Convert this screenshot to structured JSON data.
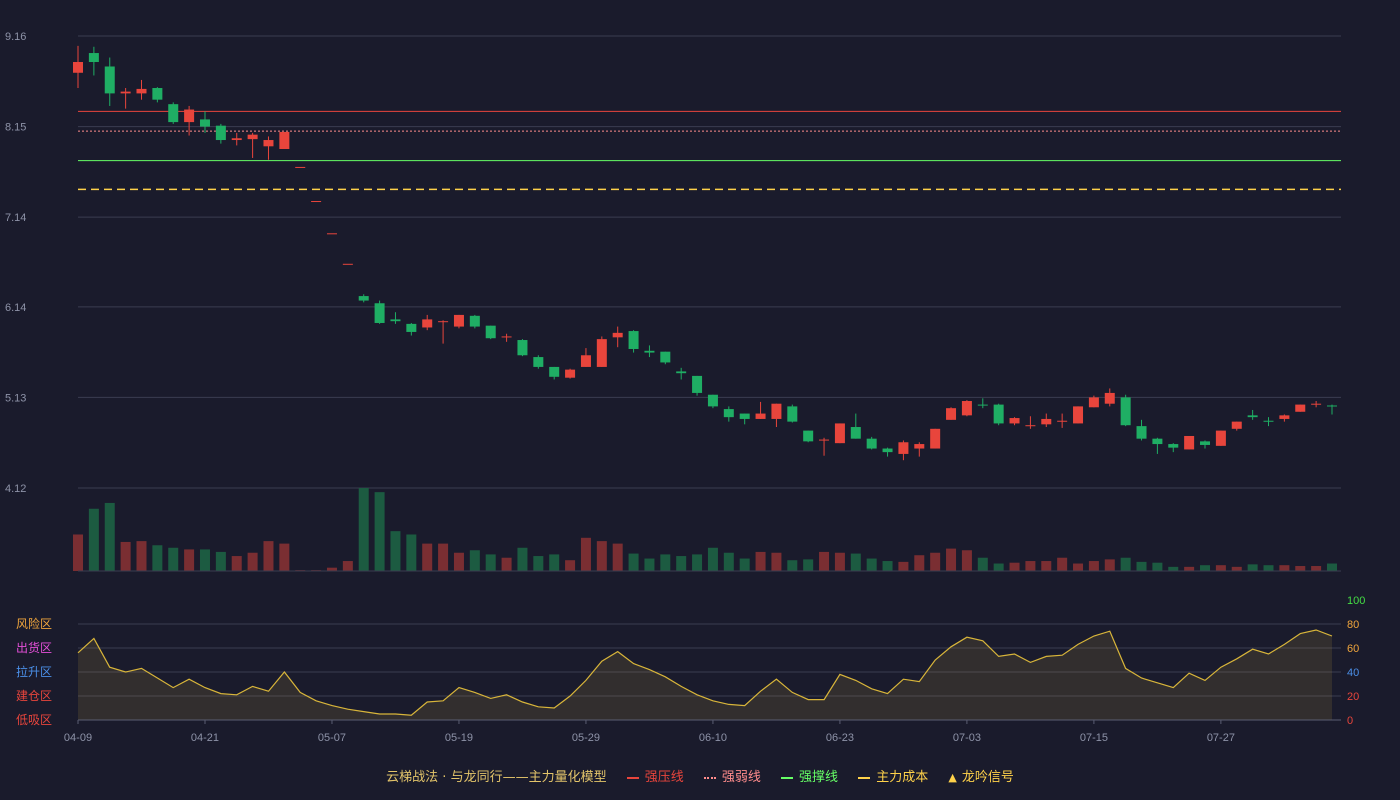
{
  "chart_data": {
    "type": "candlestick",
    "title": "",
    "price_axis": {
      "ticks": [
        "9.16",
        "8.15",
        "7.14",
        "6.14",
        "5.13",
        "4.12"
      ],
      "ylim": [
        4.12,
        9.16
      ]
    },
    "indicator_axis": {
      "ticks": [
        "100",
        "80",
        "60",
        "40",
        "20",
        "0"
      ],
      "ylim": [
        0,
        100
      ]
    },
    "zones": [
      "风险区",
      "出货区",
      "拉升区",
      "建仓区",
      "低吸区"
    ],
    "x_ticks": [
      "04-09",
      "04-21",
      "05-07",
      "05-19",
      "05-29",
      "06-10",
      "06-23",
      "07-03",
      "07-15",
      "07-27"
    ],
    "x_tick_index": [
      0,
      8,
      16,
      24,
      32,
      40,
      48,
      56,
      64,
      72
    ],
    "lines": {
      "strong_resist": 8.32,
      "weak_resist": 8.1,
      "support": 7.77,
      "main_cost": 7.45
    },
    "candles": [
      [
        8.75,
        8.87,
        9.05,
        8.58
      ],
      [
        8.97,
        8.87,
        9.04,
        8.72
      ],
      [
        8.82,
        8.52,
        8.92,
        8.38
      ],
      [
        8.52,
        8.54,
        8.58,
        8.35
      ],
      [
        8.52,
        8.57,
        8.67,
        8.45
      ],
      [
        8.58,
        8.45,
        8.59,
        8.42
      ],
      [
        8.4,
        8.2,
        8.42,
        8.18
      ],
      [
        8.2,
        8.34,
        8.38,
        8.05
      ],
      [
        8.23,
        8.15,
        8.32,
        8.08
      ],
      [
        8.16,
        8.0,
        8.18,
        7.96
      ],
      [
        8.0,
        8.02,
        8.08,
        7.94
      ],
      [
        8.01,
        8.06,
        8.08,
        7.8
      ],
      [
        7.93,
        8.0,
        8.04,
        7.78
      ],
      [
        7.9,
        8.09,
        8.09,
        7.9
      ],
      [
        7.7,
        7.7,
        7.7,
        7.7
      ],
      [
        7.32,
        7.32,
        7.32,
        7.32
      ],
      [
        6.96,
        6.96,
        6.96,
        6.96
      ],
      [
        6.62,
        6.62,
        6.62,
        6.62
      ],
      [
        6.26,
        6.21,
        6.28,
        6.19
      ],
      [
        6.18,
        5.96,
        6.21,
        5.95
      ],
      [
        6.0,
        5.98,
        6.08,
        5.95
      ],
      [
        5.95,
        5.86,
        5.96,
        5.82
      ],
      [
        5.91,
        6.0,
        6.05,
        5.88
      ],
      [
        5.98,
        5.98,
        5.99,
        5.73
      ],
      [
        5.92,
        6.05,
        6.05,
        5.9
      ],
      [
        6.04,
        5.92,
        6.05,
        5.9
      ],
      [
        5.93,
        5.79,
        5.93,
        5.78
      ],
      [
        5.8,
        5.81,
        5.84,
        5.75
      ],
      [
        5.77,
        5.6,
        5.78,
        5.59
      ],
      [
        5.58,
        5.47,
        5.6,
        5.45
      ],
      [
        5.47,
        5.36,
        5.47,
        5.33
      ],
      [
        5.35,
        5.44,
        5.45,
        5.34
      ],
      [
        5.47,
        5.6,
        5.68,
        5.47
      ],
      [
        5.47,
        5.78,
        5.81,
        5.47
      ],
      [
        5.8,
        5.85,
        5.92,
        5.69
      ],
      [
        5.87,
        5.67,
        5.88,
        5.63
      ],
      [
        5.65,
        5.63,
        5.71,
        5.58
      ],
      [
        5.64,
        5.52,
        5.64,
        5.5
      ],
      [
        5.42,
        5.4,
        5.46,
        5.33
      ],
      [
        5.37,
        5.18,
        5.37,
        5.15
      ],
      [
        5.16,
        5.03,
        5.16,
        5.01
      ],
      [
        5.0,
        4.91,
        5.03,
        4.86
      ],
      [
        4.95,
        4.89,
        4.95,
        4.83
      ],
      [
        4.89,
        4.95,
        5.08,
        4.89
      ],
      [
        4.89,
        5.06,
        5.06,
        4.8
      ],
      [
        5.03,
        4.86,
        5.05,
        4.85
      ],
      [
        4.76,
        4.64,
        4.76,
        4.63
      ],
      [
        4.66,
        4.66,
        4.68,
        4.48
      ],
      [
        4.62,
        4.84,
        4.84,
        4.62
      ],
      [
        4.8,
        4.67,
        4.95,
        4.67
      ],
      [
        4.67,
        4.56,
        4.69,
        4.55
      ],
      [
        4.56,
        4.52,
        4.57,
        4.47
      ],
      [
        4.5,
        4.63,
        4.65,
        4.43
      ],
      [
        4.56,
        4.61,
        4.63,
        4.47
      ],
      [
        4.56,
        4.78,
        4.78,
        4.56
      ],
      [
        4.88,
        5.01,
        5.02,
        4.88
      ],
      [
        4.93,
        5.09,
        5.1,
        4.92
      ],
      [
        5.05,
        5.04,
        5.12,
        5.01
      ],
      [
        5.05,
        4.84,
        5.06,
        4.82
      ],
      [
        4.84,
        4.9,
        4.91,
        4.82
      ],
      [
        4.82,
        4.82,
        4.92,
        4.78
      ],
      [
        4.83,
        4.89,
        4.95,
        4.8
      ],
      [
        4.87,
        4.87,
        4.95,
        4.79
      ],
      [
        4.84,
        5.03,
        5.03,
        4.84
      ],
      [
        5.02,
        5.13,
        5.15,
        5.02
      ],
      [
        5.06,
        5.18,
        5.23,
        5.03
      ],
      [
        5.13,
        4.82,
        5.16,
        4.81
      ],
      [
        4.81,
        4.67,
        4.88,
        4.65
      ],
      [
        4.67,
        4.61,
        4.68,
        4.5
      ],
      [
        4.61,
        4.57,
        4.62,
        4.52
      ],
      [
        4.55,
        4.7,
        4.7,
        4.55
      ],
      [
        4.64,
        4.6,
        4.65,
        4.56
      ],
      [
        4.59,
        4.76,
        4.76,
        4.59
      ],
      [
        4.78,
        4.86,
        4.86,
        4.76
      ],
      [
        4.93,
        4.91,
        4.99,
        4.88
      ],
      [
        4.87,
        4.86,
        4.91,
        4.81
      ],
      [
        4.89,
        4.93,
        4.94,
        4.86
      ],
      [
        4.97,
        5.05,
        5.05,
        4.97
      ],
      [
        5.05,
        5.06,
        5.09,
        5.02
      ],
      [
        5.04,
        5.03,
        5.05,
        4.94
      ]
    ],
    "volume_rel": [
      0.44,
      0.75,
      0.82,
      0.35,
      0.36,
      0.31,
      0.28,
      0.26,
      0.26,
      0.23,
      0.18,
      0.22,
      0.36,
      0.33,
      0.01,
      0.01,
      0.04,
      0.12,
      1.0,
      0.95,
      0.48,
      0.44,
      0.33,
      0.33,
      0.22,
      0.25,
      0.2,
      0.16,
      0.28,
      0.18,
      0.2,
      0.13,
      0.4,
      0.36,
      0.33,
      0.21,
      0.15,
      0.2,
      0.18,
      0.2,
      0.28,
      0.22,
      0.15,
      0.23,
      0.22,
      0.13,
      0.14,
      0.23,
      0.22,
      0.21,
      0.15,
      0.12,
      0.11,
      0.19,
      0.22,
      0.27,
      0.25,
      0.16,
      0.09,
      0.1,
      0.12,
      0.12,
      0.16,
      0.09,
      0.12,
      0.14,
      0.16,
      0.11,
      0.1,
      0.05,
      0.05,
      0.07,
      0.07,
      0.05,
      0.08,
      0.07,
      0.07,
      0.06,
      0.06,
      0.09
    ],
    "indicator": [
      56,
      68,
      44,
      40,
      43,
      35,
      27,
      34,
      27,
      22,
      21,
      28,
      24,
      40,
      23,
      16,
      12,
      9,
      7,
      5,
      5,
      4,
      15,
      16,
      27,
      23,
      18,
      21,
      15,
      11,
      10,
      20,
      33,
      49,
      57,
      47,
      42,
      36,
      28,
      21,
      16,
      13,
      12,
      24,
      34,
      23,
      17,
      17,
      38,
      33,
      26,
      22,
      34,
      32,
      50,
      61,
      69,
      66,
      53,
      55,
      48,
      53,
      54,
      63,
      70,
      74,
      43,
      35,
      31,
      27,
      39,
      33,
      44,
      51,
      59,
      55,
      63,
      72,
      75,
      70
    ]
  },
  "legend": {
    "model_label": "云梯战法 · 与龙同行——主力量化模型",
    "items": [
      {
        "label": "强压线",
        "color": "#e8453c",
        "style": "solid"
      },
      {
        "label": "强弱线",
        "color": "#ff8c8c",
        "style": "dotted"
      },
      {
        "label": "强撑线",
        "color": "#66ff66",
        "style": "solid"
      },
      {
        "label": "主力成本",
        "color": "#ffd24a",
        "style": "dashed"
      },
      {
        "label": "龙吟信号",
        "color": "#ffd24a",
        "style": "triangle"
      }
    ]
  },
  "colors": {
    "up": "#e8453c",
    "down": "#1fae64",
    "grid": "#3a3c50",
    "text": "#8e93a8",
    "indicator_line": "#d8b53a",
    "zone_risk": "#f0a53c",
    "zone_ship": "#e44fd8",
    "zone_lift": "#4b8fe8",
    "zone_build": "#e8453c",
    "zone_low": "#e8453c",
    "vol_axis": "#44dd44"
  }
}
